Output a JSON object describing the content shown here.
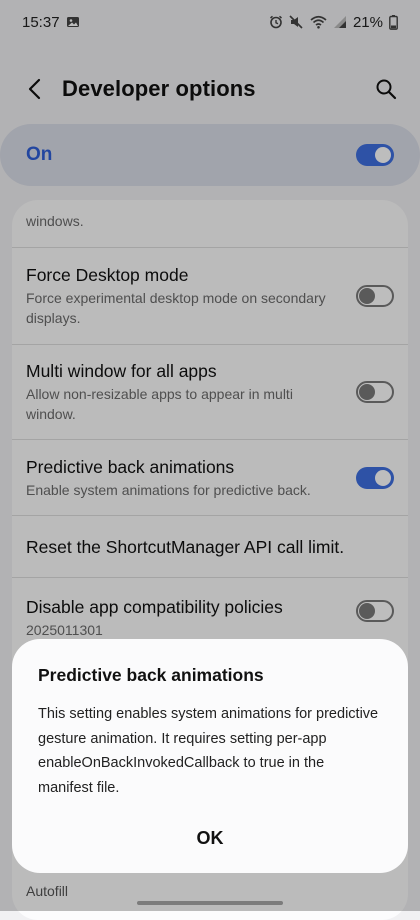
{
  "status_bar": {
    "time": "15:37",
    "battery": "21%"
  },
  "header": {
    "title": "Developer options"
  },
  "master_switch": {
    "label": "On",
    "state": "on"
  },
  "rows": [
    {
      "title": "",
      "subtitle": "windows.",
      "toggle": "off"
    },
    {
      "title": "Force Desktop mode",
      "subtitle": "Force experimental desktop mode on secondary displays.",
      "toggle": "off"
    },
    {
      "title": "Multi window for all apps",
      "subtitle": "Allow non-resizable apps to appear in multi window.",
      "toggle": "off"
    },
    {
      "title": "Predictive back animations",
      "subtitle": "Enable system animations for predictive back.",
      "toggle": "on"
    },
    {
      "title": "Reset the ShortcutManager API call limit.",
      "subtitle": "",
      "toggle": "none"
    },
    {
      "title": "Disable app compatibility policies",
      "subtitle": "2025011301",
      "toggle": "off"
    }
  ],
  "dialog": {
    "title": "Predictive back animations",
    "message": "This setting enables system animations for predictive gesture animation. It requires setting per-app enableOnBackInvokedCallback to true in the manifest file.",
    "ok_label": "OK"
  },
  "below_text": "Autofill",
  "colors": {
    "accent": "#3e6fe0",
    "master_bg": "#dadde8",
    "page_bg": "#f1f1f3"
  }
}
